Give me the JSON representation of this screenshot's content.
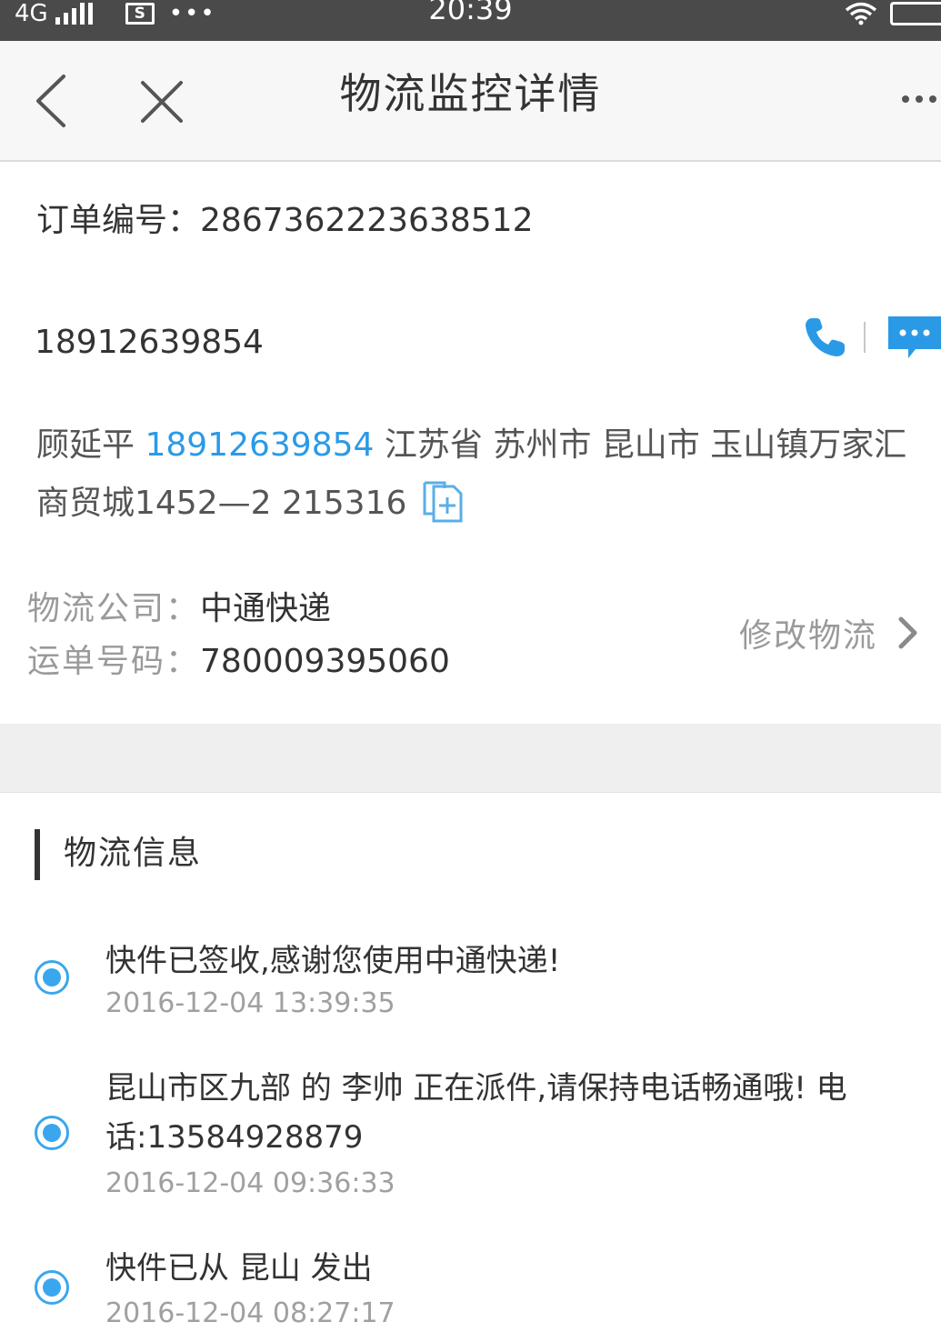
{
  "status_bar": {
    "network": "4G",
    "time": "20:39",
    "sim_label": "S",
    "dots": "•••"
  },
  "nav": {
    "title": "物流监控详情"
  },
  "order": {
    "order_label": "订单编号：",
    "order_number": "2867362223638512",
    "contact_phone": "18912639854"
  },
  "address": {
    "name": "顾延平",
    "phone": "18912639854",
    "detail": "江苏省 苏州市 昆山市 玉山镇万家汇商贸城1452—2 215316"
  },
  "logistics": {
    "company_label": "物流公司：",
    "company": "中通快递",
    "waybill_label": "运单号码：",
    "waybill": "780009395060",
    "modify_label": "修改物流"
  },
  "info": {
    "section_title": "物流信息",
    "events": [
      {
        "text": "快件已签收,感谢您使用中通快递!",
        "time": "2016-12-04 13:39:35"
      },
      {
        "text": "昆山市区九部 的 李帅 正在派件,请保持电话畅通哦! 电话:13584928879",
        "time": "2016-12-04 09:36:33"
      },
      {
        "text": "快件已从 昆山 发出",
        "time": "2016-12-04 08:27:17"
      }
    ]
  },
  "colors": {
    "accent": "#3aa6ee",
    "link": "#2b9ae6",
    "status_bar": "#4a4a4a"
  }
}
